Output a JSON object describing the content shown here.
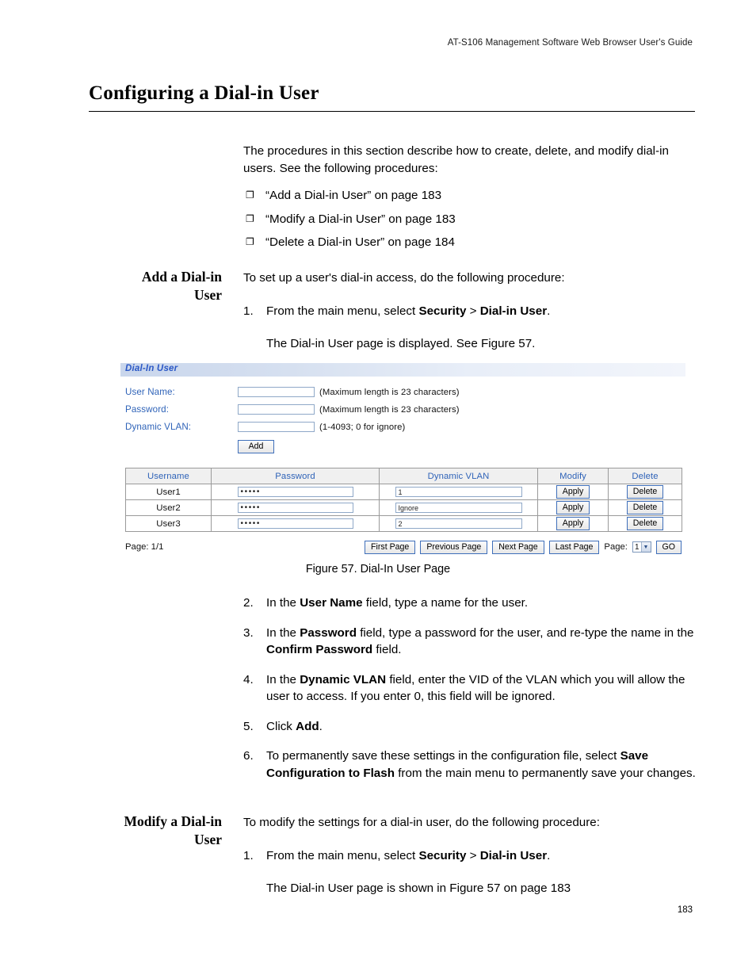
{
  "header": {
    "running_title": "AT-S106 Management Software Web Browser User's Guide"
  },
  "chapter": {
    "title": "Configuring a Dial-in User"
  },
  "intro": {
    "paragraph": "The procedures in this section describe how to create, delete, and modify dial-in users. See the following procedures:",
    "bullet_glyph": "❐",
    "bullets": [
      "“Add a Dial-in User” on page 183",
      "“Modify a Dial-in User” on page 183",
      "“Delete a Dial-in User” on page 184"
    ]
  },
  "add_section": {
    "heading_line1": "Add a Dial-in",
    "heading_line2": "User",
    "lead": "To set up a user's dial-in access, do the following procedure:",
    "step1_num": "1.",
    "step1_pre": "From the main menu, select ",
    "step1_bold1": "Security",
    "step1_mid": " > ",
    "step1_bold2": "Dial-in User",
    "step1_post": ".",
    "step1_sub": "The Dial-in User page is displayed. See Figure 57.",
    "step2_num": "2.",
    "step2_pre": "In the ",
    "step2_bold1": "User Name",
    "step2_post": " field, type a name for the user.",
    "step3_num": "3.",
    "step3_pre": "In the ",
    "step3_bold1": "Password",
    "step3_mid": " field, type a password for the user, and re-type the name in the ",
    "step3_bold2": "Confirm Password",
    "step3_post": " field.",
    "step4_num": "4.",
    "step4_pre": "In the ",
    "step4_bold1": "Dynamic VLAN",
    "step4_post": " field, enter the VID of the VLAN which you will allow the user to access. If you enter 0, this field will be ignored.",
    "step5_num": "5.",
    "step5_pre": "Click ",
    "step5_bold1": "Add",
    "step5_post": ".",
    "step6_num": "6.",
    "step6_pre": "To permanently save these settings in the configuration file, select ",
    "step6_bold1": "Save Configuration to Flash",
    "step6_post": " from the main menu to permanently save your changes."
  },
  "modify_section": {
    "heading_line1": "Modify a Dial-in",
    "heading_line2": "User",
    "lead": "To modify the settings for a dial-in user, do the following procedure:",
    "step1_num": "1.",
    "step1_pre": "From the main menu, select ",
    "step1_bold1": "Security",
    "step1_mid": " > ",
    "step1_bold2": "Dial-in User",
    "step1_post": ".",
    "step1_sub": "The Dial-in User page is shown in Figure 57 on page 183"
  },
  "figure": {
    "caption": "Figure 57. Dial-In User Page",
    "panel_title": "Dial-In User",
    "form": {
      "rows": [
        {
          "label": "User Name:",
          "value": "",
          "hint": "(Maximum length is 23 characters)"
        },
        {
          "label": "Password:",
          "value": "",
          "hint": "(Maximum length is 23 characters)"
        },
        {
          "label": "Dynamic VLAN:",
          "value": "",
          "hint": "(1-4093; 0 for ignore)"
        }
      ],
      "add_button": "Add"
    },
    "table": {
      "columns": [
        "Username",
        "Password",
        "Dynamic VLAN",
        "Modify",
        "Delete"
      ],
      "rows": [
        {
          "username": "User1",
          "password": "•••••",
          "vlan": "1",
          "modify": "Apply",
          "delete": "Delete"
        },
        {
          "username": "User2",
          "password": "•••••",
          "vlan": "Ignore",
          "modify": "Apply",
          "delete": "Delete"
        },
        {
          "username": "User3",
          "password": "•••••",
          "vlan": "2",
          "modify": "Apply",
          "delete": "Delete"
        }
      ]
    },
    "pager": {
      "indicator": "Page: 1/1",
      "first": "First Page",
      "previous": "Previous Page",
      "next": "Next Page",
      "last": "Last Page",
      "page_label": "Page:",
      "page_value": "1",
      "go": "GO",
      "arrow_glyph": "▼"
    }
  },
  "footer": {
    "page_number": "183"
  },
  "colors": {
    "link_blue": "#2b58c6",
    "label_blue": "#2f63b8",
    "panel_gradient_start": "#c9d6ec",
    "button_border": "#3f6fba"
  }
}
